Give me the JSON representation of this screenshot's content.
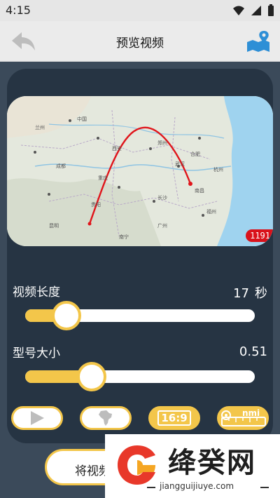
{
  "status_bar": {
    "time": "4:15"
  },
  "app_bar": {
    "title": "预览视频"
  },
  "map": {
    "count_badge": "1191",
    "labels": [
      "中国",
      "长沙",
      "武汉",
      "南昌",
      "重庆",
      "贵阳",
      "南宁",
      "成都",
      "西安",
      "郑州",
      "合肥",
      "杭州",
      "福州",
      "广州",
      "兰州",
      "昆明"
    ]
  },
  "video_length": {
    "label": "视频长度",
    "value": "17",
    "unit": "秒",
    "fraction": 0.18
  },
  "model_size": {
    "label": "型号大小",
    "value": "0.51",
    "fraction": 0.29
  },
  "mode_buttons": [
    {
      "name": "play",
      "active": false
    },
    {
      "name": "africa-map",
      "active": false
    },
    {
      "name": "ratio",
      "text": "16:9",
      "active": true
    },
    {
      "name": "distance-unit",
      "text": "nmi",
      "active": true
    }
  ],
  "export_button": {
    "label": "将视频"
  },
  "watermark": {
    "title": "绛癸网",
    "url": "jiangguijiuye.com"
  },
  "colors": {
    "accent": "#f3c64a",
    "panel": "#263443",
    "background": "#3b4a5a",
    "route": "#e0151b"
  }
}
